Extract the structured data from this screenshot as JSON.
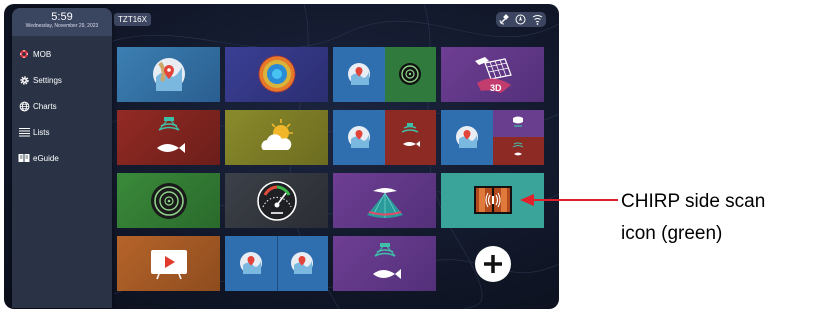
{
  "status_bar": {
    "time": "5:59",
    "date": "Wednesday, November 29, 2023",
    "device_tag": "TZT16X"
  },
  "sidebar": {
    "items": [
      {
        "label": "MOB",
        "icon": "mob-lifebuoy-icon"
      },
      {
        "label": "Settings",
        "icon": "gear-icon"
      },
      {
        "label": "Charts",
        "icon": "globe-icon"
      },
      {
        "label": "Lists",
        "icon": "list-icon"
      },
      {
        "label": "eGuide",
        "icon": "book-icon"
      }
    ]
  },
  "tiles": [
    {
      "name": "chart",
      "icon": "chart-pin-icon"
    },
    {
      "name": "radar",
      "icon": "radar-sweep-icon"
    },
    {
      "name": "chart-plus-radar",
      "icon": "chart-radar-split-icon"
    },
    {
      "name": "3d-view",
      "icon": "3d-view-icon"
    },
    {
      "name": "fish-finder",
      "icon": "fish-finder-icon"
    },
    {
      "name": "weather",
      "icon": "weather-icon"
    },
    {
      "name": "chart-plus-fish-finder",
      "icon": "chart-fishfinder-split-icon"
    },
    {
      "name": "chart-plus-multi",
      "icon": "chart-multi-split-icon"
    },
    {
      "name": "sonar-scan",
      "icon": "sonar-scan-icon"
    },
    {
      "name": "instruments",
      "icon": "gauge-icon"
    },
    {
      "name": "360-frontscan",
      "icon": "frontscan-icon"
    },
    {
      "name": "chirp-side-scan",
      "icon": "chirp-side-scan-icon"
    },
    {
      "name": "video",
      "icon": "video-play-icon"
    },
    {
      "name": "dual-chart",
      "icon": "dual-chart-icon"
    },
    {
      "name": "fish-finder-2",
      "icon": "fish-finder-purple-icon"
    },
    {
      "name": "add-page",
      "icon": "plus-icon"
    }
  ],
  "annotation": {
    "line1": "CHIRP side scan",
    "line2": "icon (green)",
    "arrow_color": "#e0202a"
  },
  "colors": {
    "chirp_tile": "#3aa39a",
    "sidebar": "#2a3346"
  }
}
